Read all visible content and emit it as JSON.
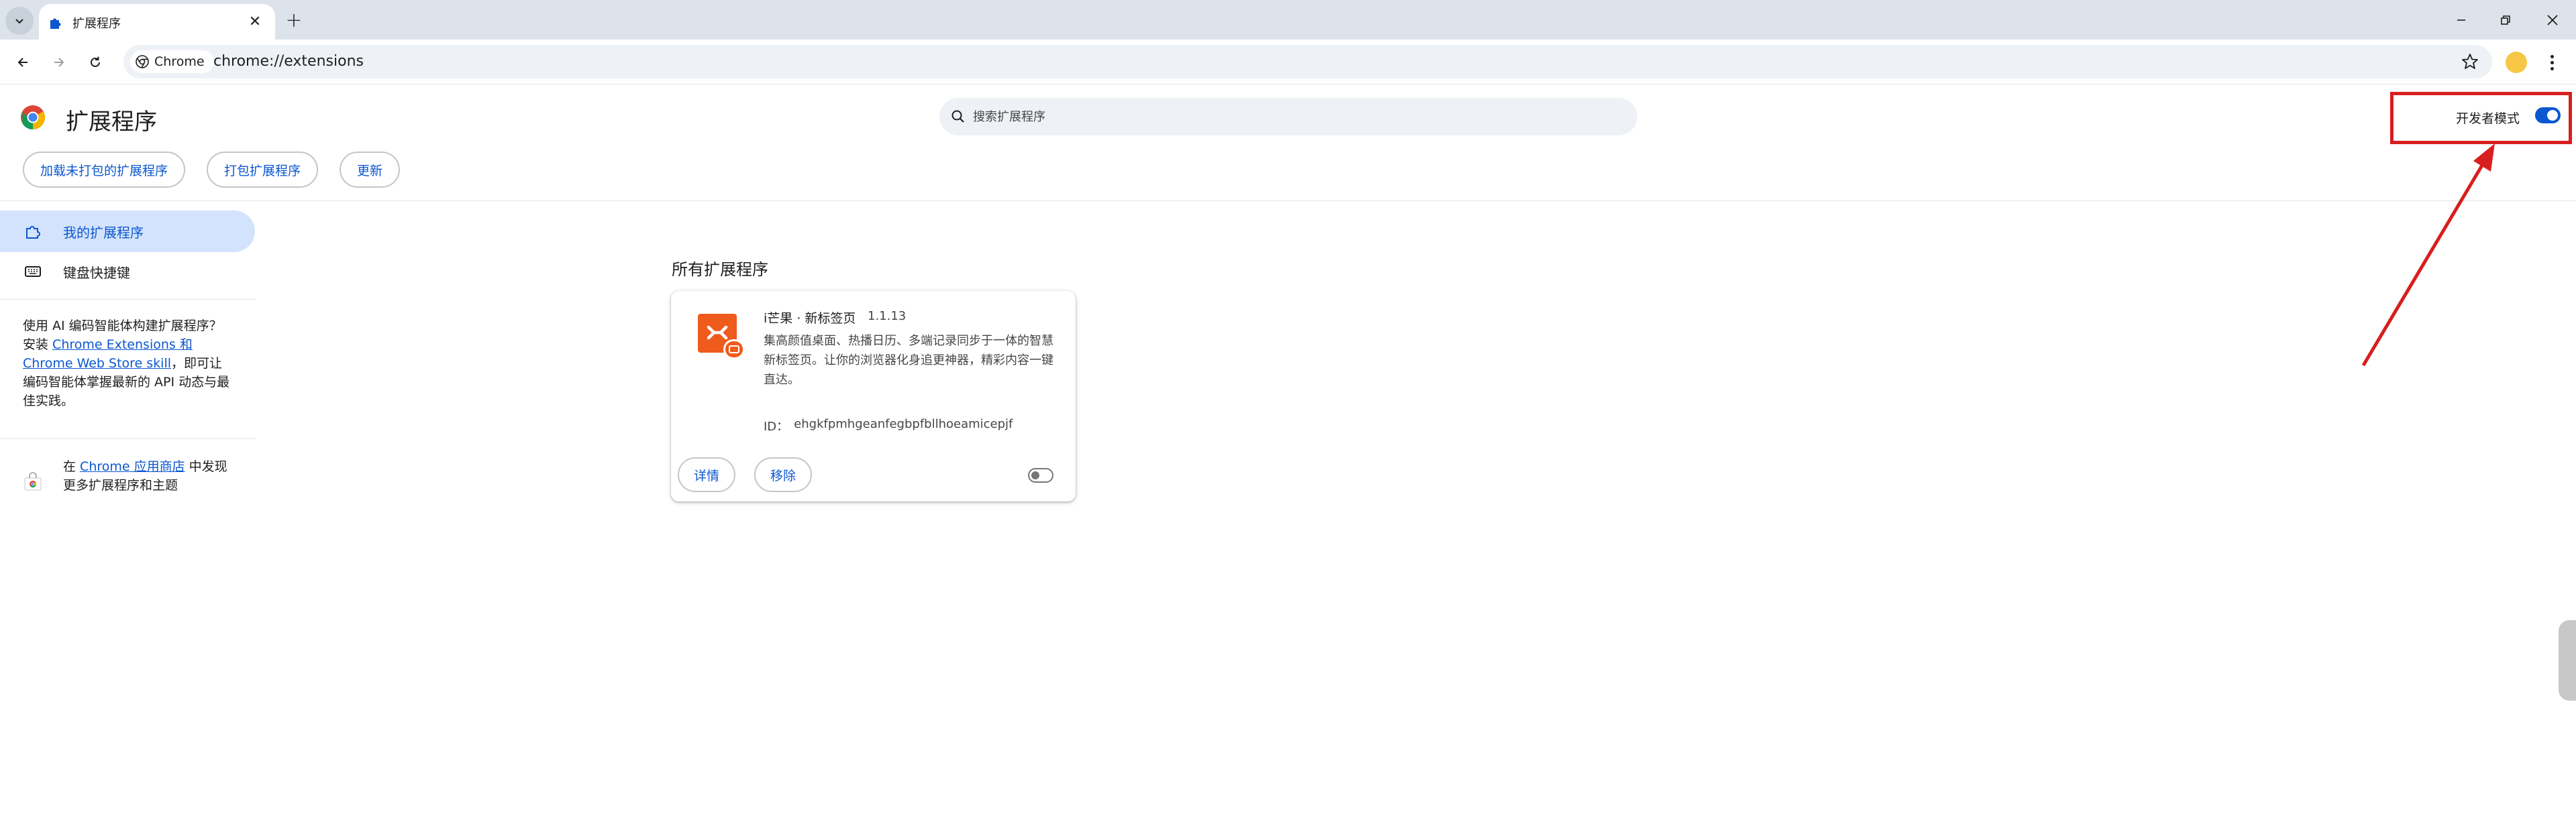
{
  "browser": {
    "tab": {
      "title": "扩展程序",
      "icon": "puzzle-icon"
    },
    "chip_label": "Chrome",
    "url": "chrome://extensions",
    "accent": "#0b57d0"
  },
  "header": {
    "title": "扩展程序",
    "search_placeholder": "搜索扩展程序",
    "dev_mode_label": "开发者模式",
    "dev_mode_on": true,
    "buttons": {
      "load_unpacked": "加载未打包的扩展程序",
      "pack": "打包扩展程序",
      "update": "更新"
    }
  },
  "sidebar": {
    "items": [
      {
        "label": "我的扩展程序",
        "icon": "puzzle-icon",
        "active": true
      },
      {
        "label": "键盘快捷键",
        "icon": "keyboard-icon",
        "active": false
      }
    ],
    "ai_text": {
      "prefix": "使用 AI 编码智能体构建扩展程序？安装 ",
      "link": "Chrome Extensions 和 Chrome Web Store skill",
      "suffix": "，即可让编码智能体掌握最新的 API 动态与最佳实践。"
    },
    "store_text": {
      "prefix": "在 ",
      "link": "Chrome 应用商店",
      "suffix": " 中发现更多扩展程序和主题"
    }
  },
  "main": {
    "section_title": "所有扩展程序",
    "extensions": [
      {
        "name": "i芒果 · 新标签页",
        "version": "1.1.13",
        "description": "集高颜值桌面、热播日历、多端记录同步于一体的智慧新标签页。让你的浏览器化身追更神器，精彩内容一键直达。",
        "id_label": "ID：",
        "id": "ehgkfpmhgeanfegbpfbllhoeamicepjf",
        "details_label": "详情",
        "remove_label": "移除",
        "enabled": false,
        "icon_color": "#ef5b1c"
      }
    ]
  },
  "annotation": {
    "color": "#d81e1e"
  }
}
